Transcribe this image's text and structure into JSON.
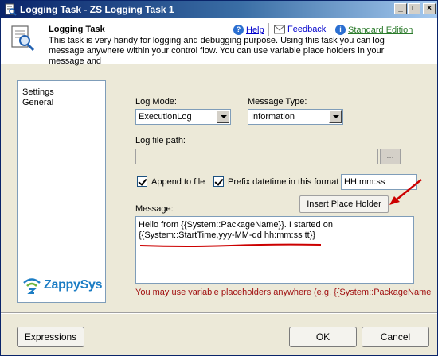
{
  "window": {
    "title": "Logging Task - ZS Logging Task 1"
  },
  "titlebar": {
    "minimize": "_",
    "maximize": "□",
    "close": "×"
  },
  "header": {
    "title": "Logging Task",
    "description": "This task is very handy for logging and debugging purpose. Using this task you can log message anywhere within your control flow. You can use variable place holders in your message and",
    "links": {
      "help": "Help",
      "feedback": "Feedback",
      "edition": "Standard Edition"
    }
  },
  "nav": {
    "items": [
      "Settings",
      "General"
    ],
    "logo_text": "ZappySys"
  },
  "form": {
    "log_mode": {
      "label": "Log Mode:",
      "value": "ExecutionLog"
    },
    "message_type": {
      "label": "Message Type:",
      "value": "Information"
    },
    "log_file_path": {
      "label": "Log file path:",
      "value": "",
      "browse": "..."
    },
    "append": {
      "label": "Append to file",
      "checked": true
    },
    "prefix": {
      "label": "Prefix datetime in this format",
      "checked": true,
      "format": "HH:mm:ss"
    },
    "insert_button": "Insert Place Holder",
    "message": {
      "label": "Message:",
      "lines": [
        "Hello from {{System::PackageName}}. I started on",
        "{{System::StartTime,yyy-MM-dd hh:mm:ss tt}}"
      ]
    },
    "hint": "You may use variable placeholders anywhere (e.g. {{System::PackageName"
  },
  "buttons": {
    "expressions": "Expressions",
    "ok": "OK",
    "cancel": "Cancel"
  },
  "colors": {
    "title_bar": "#0a246a",
    "annotation": "#cc0000",
    "link": "#0000cc",
    "logo": "#1c7dc4"
  }
}
